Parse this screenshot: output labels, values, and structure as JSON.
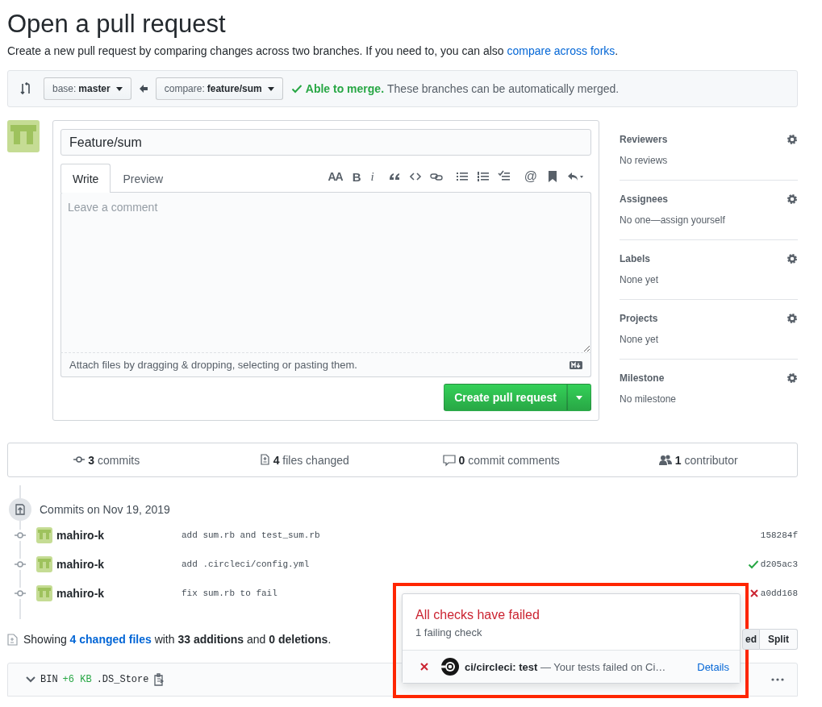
{
  "page_title": "Open a pull request",
  "description": {
    "text": "Create a new pull request by comparing changes across two branches. If you need to, you can also ",
    "link": "compare across forks",
    "end": "."
  },
  "range": {
    "base": {
      "prefix": "base:",
      "branch": "master"
    },
    "compare": {
      "prefix": "compare:",
      "branch": "feature/sum"
    },
    "merge_status": "Able to merge.",
    "merge_message": "These branches can be automatically merged."
  },
  "form": {
    "title_value": "Feature/sum",
    "tabs": [
      {
        "label": "Write",
        "selected": true
      },
      {
        "label": "Preview",
        "selected": false
      }
    ],
    "toolbar": [
      [
        {
          "kind": "heading",
          "label": "AA"
        },
        {
          "kind": "bold",
          "label": "B"
        },
        {
          "kind": "italic",
          "label": "i"
        }
      ],
      [
        {
          "kind": "quote"
        },
        {
          "kind": "code"
        },
        {
          "kind": "link"
        }
      ],
      [
        {
          "kind": "bullets"
        },
        {
          "kind": "numbers"
        },
        {
          "kind": "tasks"
        }
      ],
      [
        {
          "kind": "mention",
          "label": "@"
        },
        {
          "kind": "bookmark"
        },
        {
          "kind": "reply"
        }
      ]
    ],
    "comment_placeholder": "Leave a comment",
    "attach_hint": "Attach files by dragging & dropping, selecting or pasting them.",
    "submit": "Create pull request"
  },
  "sidebar": [
    {
      "heading": "Reviewers",
      "value": "No reviews"
    },
    {
      "heading": "Assignees",
      "value": "No one—assign yourself"
    },
    {
      "heading": "Labels",
      "value": "None yet"
    },
    {
      "heading": "Projects",
      "value": "None yet"
    },
    {
      "heading": "Milestone",
      "value": "No milestone"
    }
  ],
  "stats": [
    {
      "kind": "commits",
      "count": "3",
      "label": "commits"
    },
    {
      "kind": "files",
      "count": "4",
      "label": "files changed"
    },
    {
      "kind": "comments",
      "count": "0",
      "label": "commit comments"
    },
    {
      "kind": "contributors",
      "count": "1",
      "label": "contributor"
    }
  ],
  "commits_heading": "Commits on Nov 19, 2019",
  "commits": [
    {
      "author": "mahiro-k",
      "message": "add sum.rb and test_sum.rb",
      "sha": "158284f",
      "kind": "plain"
    },
    {
      "author": "mahiro-k",
      "message": "add .circleci/config.yml",
      "sha": "d205ac3",
      "kind": "passed"
    },
    {
      "author": "mahiro-k",
      "message": "fix sum.rb to fail",
      "sha": "a0dd168",
      "kind": "failed"
    }
  ],
  "summary": {
    "prefix": "Showing ",
    "link": "4 changed files",
    "rest": " with **33 additions** and **0 deletions**."
  },
  "diff_view": [
    {
      "label": "ed",
      "selected": true
    },
    {
      "label": "Split",
      "selected": false
    }
  ],
  "file": {
    "type": "BIN",
    "size": "+6 KB",
    "name": ".DS_Store"
  },
  "checks_popover": {
    "highlighted": true,
    "title": "All checks have failed",
    "subtitle": "1 failing check",
    "checks": [
      {
        "kind": "failed",
        "name": "ci/circleci: test",
        "description": " — Your tests failed on Ci…",
        "link": "Details"
      }
    ]
  }
}
